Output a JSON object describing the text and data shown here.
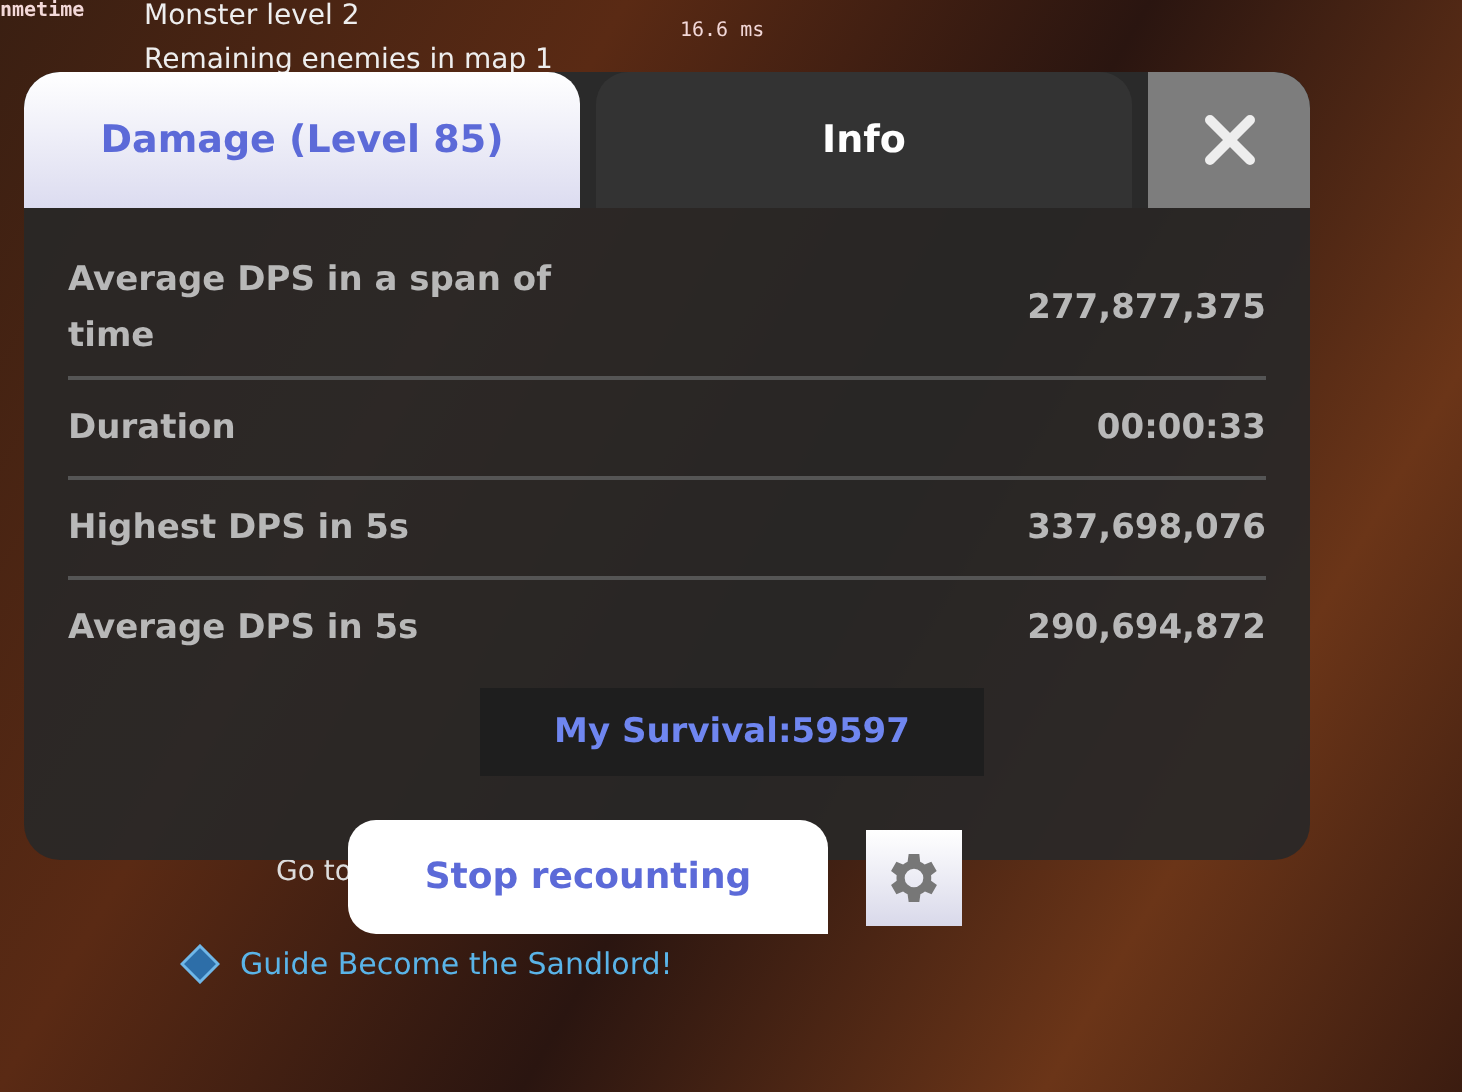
{
  "hud": {
    "corner_label": "nmetime",
    "monster_level": "Monster level 2",
    "remaining_enemies": "Remaining enemies in map 1",
    "frame_time": "16.6 ms"
  },
  "tabs": [
    {
      "label": "Damage (Level 85)",
      "selected": true
    },
    {
      "label": "Info",
      "selected": false
    }
  ],
  "stats": [
    {
      "label": "Average DPS in a span of time",
      "value": "277,877,375"
    },
    {
      "label": "Duration",
      "value": "00:00:33"
    },
    {
      "label": "Highest DPS in 5s",
      "value": "337,698,076"
    },
    {
      "label": "Average DPS in 5s",
      "value": "290,694,872"
    }
  ],
  "survival": "My Survival:59597",
  "stop_button": "Stop recounting",
  "quest": {
    "step": "Go to",
    "guide": "Guide Become the Sandlord!"
  }
}
